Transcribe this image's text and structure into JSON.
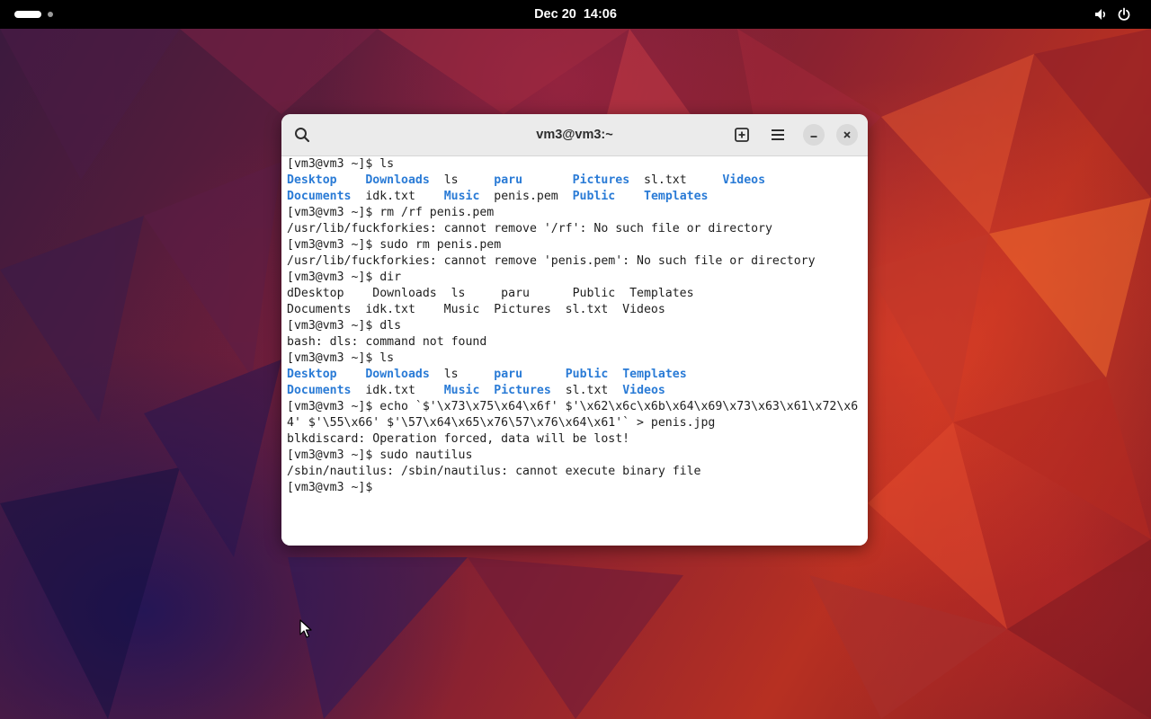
{
  "topbar": {
    "date": "Dec 20",
    "time": "14:06",
    "icons": [
      "activities-indicator",
      "volume-icon",
      "power-icon"
    ]
  },
  "window": {
    "title": "vm3@vm3:~",
    "buttons": [
      "search-icon",
      "new-tab-icon",
      "menu-icon",
      "minimize-icon",
      "close-icon"
    ]
  },
  "colors": {
    "directory": "#2a7bd6",
    "text": "#1e1e1e",
    "headerbar": "#ebebeb"
  },
  "terminal": {
    "lines": [
      [
        {
          "t": "[vm3@vm3 ~]$ ls"
        }
      ],
      [
        {
          "t": "Desktop",
          "c": "dir"
        },
        {
          "t": "    "
        },
        {
          "t": "Downloads",
          "c": "dir"
        },
        {
          "t": "  ls     "
        },
        {
          "t": "paru",
          "c": "dir"
        },
        {
          "t": "       "
        },
        {
          "t": "Pictures",
          "c": "dir"
        },
        {
          "t": "  sl.txt     "
        },
        {
          "t": "Videos",
          "c": "dir"
        }
      ],
      [
        {
          "t": "Documents",
          "c": "dir"
        },
        {
          "t": "  idk.txt    "
        },
        {
          "t": "Music",
          "c": "dir"
        },
        {
          "t": "  penis.pem  "
        },
        {
          "t": "Public",
          "c": "dir"
        },
        {
          "t": "    "
        },
        {
          "t": "Templates",
          "c": "dir"
        }
      ],
      [
        {
          "t": "[vm3@vm3 ~]$ rm /rf penis.pem"
        }
      ],
      [
        {
          "t": "/usr/lib/fuckforkies: cannot remove '/rf': No such file or directory"
        }
      ],
      [
        {
          "t": "[vm3@vm3 ~]$ sudo rm penis.pem"
        }
      ],
      [
        {
          "t": "/usr/lib/fuckforkies: cannot remove 'penis.pem': No such file or directory"
        }
      ],
      [
        {
          "t": "[vm3@vm3 ~]$ dir"
        }
      ],
      [
        {
          "t": "dDesktop    Downloads  ls     paru      Public  Templates"
        }
      ],
      [
        {
          "t": "Documents  idk.txt    Music  Pictures  sl.txt  Videos"
        }
      ],
      [
        {
          "t": "[vm3@vm3 ~]$ dls"
        }
      ],
      [
        {
          "t": "bash: dls: command not found"
        }
      ],
      [
        {
          "t": "[vm3@vm3 ~]$ ls"
        }
      ],
      [
        {
          "t": "Desktop",
          "c": "dir"
        },
        {
          "t": "    "
        },
        {
          "t": "Downloads",
          "c": "dir"
        },
        {
          "t": "  ls     "
        },
        {
          "t": "paru",
          "c": "dir"
        },
        {
          "t": "      "
        },
        {
          "t": "Public",
          "c": "dir"
        },
        {
          "t": "  "
        },
        {
          "t": "Templates",
          "c": "dir"
        }
      ],
      [
        {
          "t": "Documents",
          "c": "dir"
        },
        {
          "t": "  idk.txt    "
        },
        {
          "t": "Music",
          "c": "dir"
        },
        {
          "t": "  "
        },
        {
          "t": "Pictures",
          "c": "dir"
        },
        {
          "t": "  sl.txt  "
        },
        {
          "t": "Videos",
          "c": "dir"
        }
      ],
      [
        {
          "t": "[vm3@vm3 ~]$ echo `$'\\x73\\x75\\x64\\x6f' $'\\x62\\x6c\\x6b\\x64\\x69\\x73\\x63\\x61\\x72\\x6"
        }
      ],
      [
        {
          "t": "4' $'\\55\\x66' $'\\57\\x64\\x65\\x76\\57\\x76\\x64\\x61'` > penis.jpg"
        }
      ],
      [
        {
          "t": "blkdiscard: Operation forced, data will be lost!"
        }
      ],
      [
        {
          "t": "[vm3@vm3 ~]$ sudo nautilus"
        }
      ],
      [
        {
          "t": "/sbin/nautilus: /sbin/nautilus: cannot execute binary file"
        }
      ],
      [
        {
          "t": "[vm3@vm3 ~]$ "
        }
      ]
    ]
  }
}
